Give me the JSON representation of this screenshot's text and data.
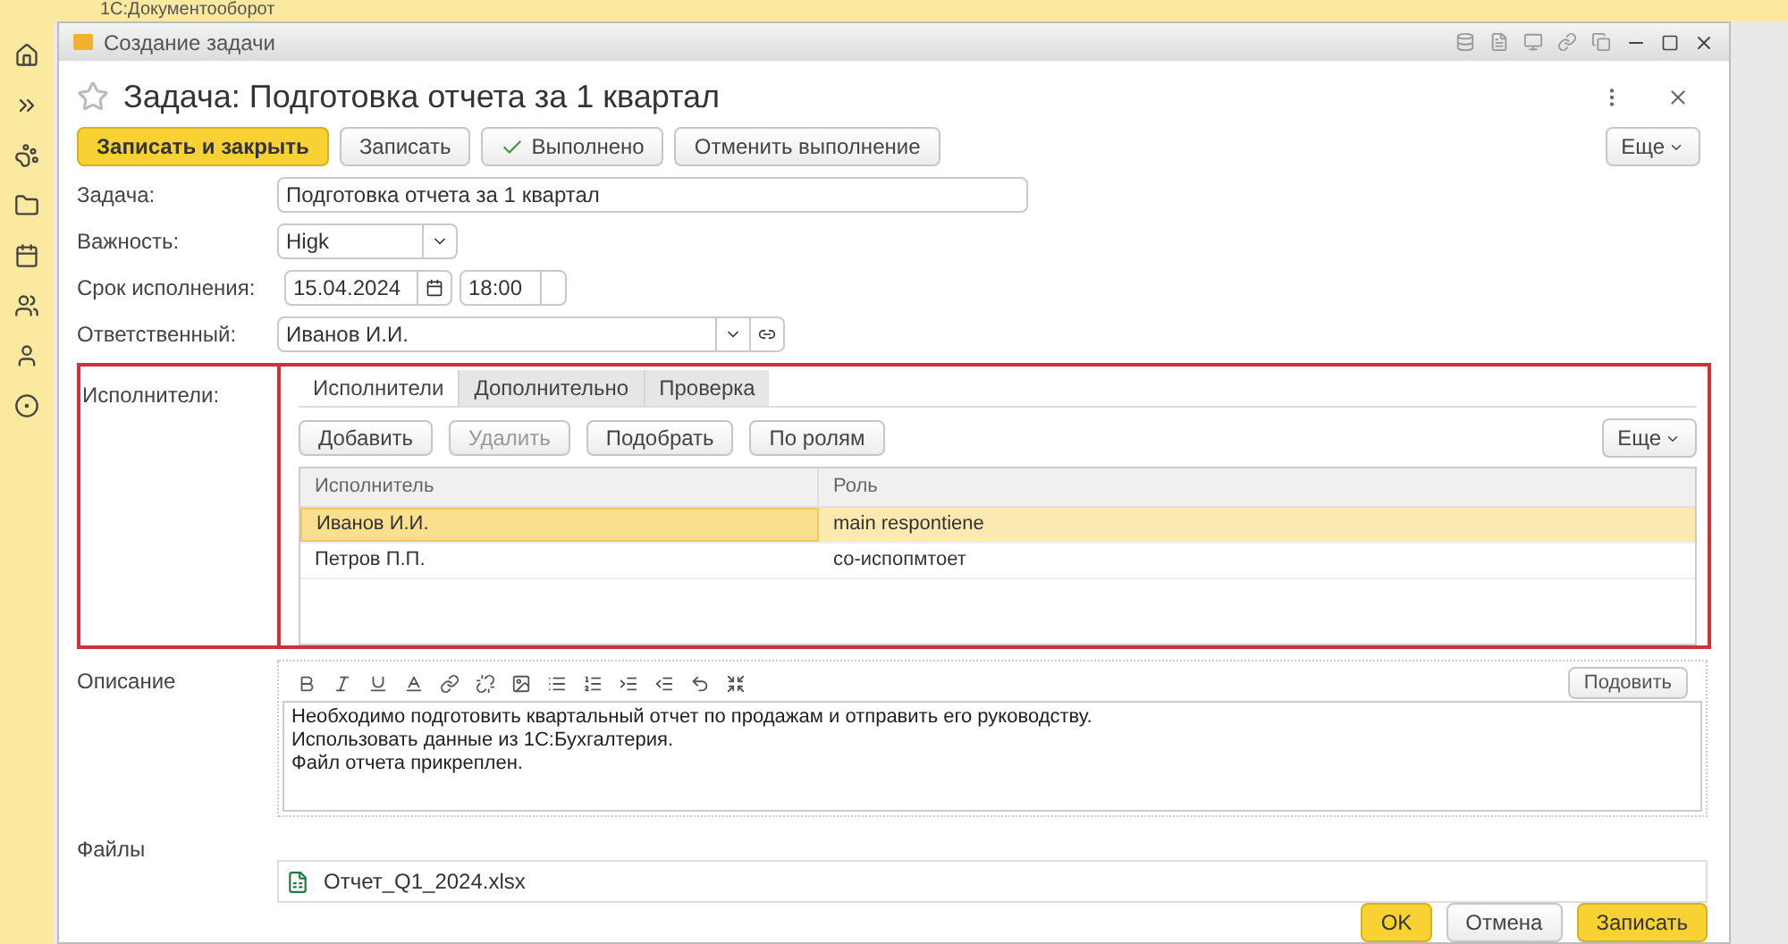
{
  "app": {
    "title": "1С:Документооборот"
  },
  "window": {
    "title": "Создание задачи"
  },
  "form": {
    "title": "Задача: Подготовка отчета за 1 квартал",
    "favorite": false
  },
  "toolbar": [
    {
      "label": "Записать и закрыть",
      "kind": "primary"
    },
    {
      "label": "Записать",
      "kind": "plain"
    },
    {
      "label": "Выполнено",
      "kind": "check"
    },
    {
      "label": "Отменить выполнение",
      "kind": "plain"
    }
  ],
  "more_button": "Еще",
  "fields": {
    "task": {
      "label": "Задача:",
      "value": "Подготовка отчета за 1 квартал"
    },
    "importance": {
      "label": "Важность:",
      "value": "Higk"
    },
    "deadline": {
      "label": "Срок исполнения:",
      "date": "15.04.2024",
      "time": "18:00"
    },
    "responsible": {
      "label": "Ответственный:",
      "value": "Иванов И.И."
    }
  },
  "performers": {
    "label": "Исполнители:",
    "highlighted": true,
    "tabs": [
      {
        "label": "Исполнители",
        "selected": true
      },
      {
        "label": "Дополнительно",
        "selected": false
      },
      {
        "label": "Проверка",
        "selected": false
      }
    ],
    "buttons": [
      {
        "label": "Добавить",
        "disabled": false
      },
      {
        "label": "Удалить",
        "disabled": true
      },
      {
        "label": "Подобрать",
        "disabled": false
      },
      {
        "label": "По ролям",
        "disabled": false
      }
    ],
    "more_button": "Еще",
    "columns": [
      "Исполнитель",
      "Роль"
    ],
    "rows": [
      {
        "performer": "Иванов И.И.",
        "role": "main respontiene",
        "selected": true
      },
      {
        "performer": "Петров П.П.",
        "role": "со-испопмтоет",
        "selected": false
      }
    ]
  },
  "description": {
    "label": "Описание",
    "action": "Подовить",
    "lines": [
      "Необходимо подготовить квартальный отчет по продажам и отправить его руководству.",
      "Использовать данные из 1С:Бухгалтерия.",
      "Файл отчета прикреплен."
    ]
  },
  "files": {
    "label": "Файлы",
    "items": [
      "Отчет_Q1_2024.xlsx"
    ]
  },
  "footer": [
    {
      "label": "OK",
      "kind": "primary"
    },
    {
      "label": "Отмена",
      "kind": "plain"
    },
    {
      "label": "Записать",
      "kind": "primary"
    }
  ]
}
